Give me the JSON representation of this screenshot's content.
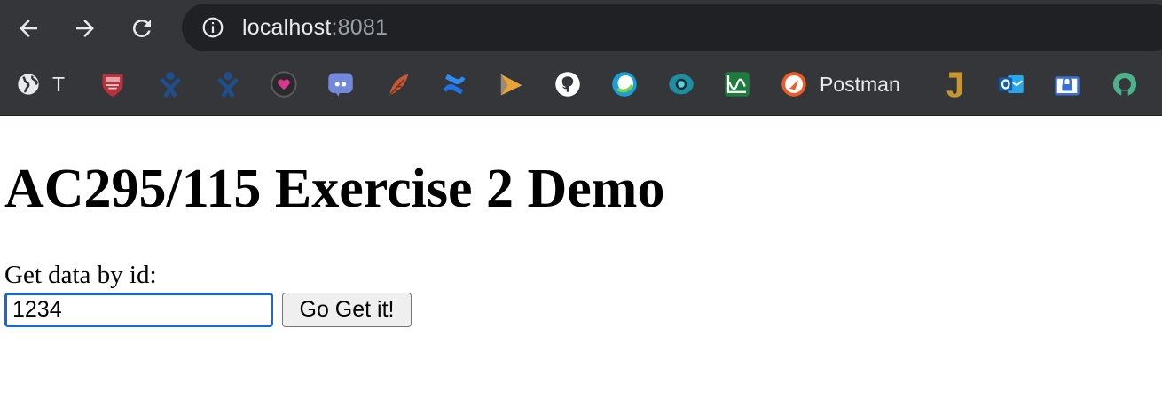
{
  "browser": {
    "url_host": "localhost",
    "url_port": ":8081",
    "bookmarks": [
      {
        "icon": "globe-icon",
        "label": "T"
      },
      {
        "icon": "shield-crest-icon",
        "label": ""
      },
      {
        "icon": "jira-person-icon",
        "label": ""
      },
      {
        "icon": "jira-person-icon",
        "label": ""
      },
      {
        "icon": "heart-icon",
        "label": ""
      },
      {
        "icon": "discord-icon",
        "label": ""
      },
      {
        "icon": "feather-icon",
        "label": ""
      },
      {
        "icon": "confluence-icon",
        "label": ""
      },
      {
        "icon": "play-arrow-icon",
        "label": ""
      },
      {
        "icon": "github-icon",
        "label": ""
      },
      {
        "icon": "circle-swirl-icon",
        "label": ""
      },
      {
        "icon": "eye-icon",
        "label": ""
      },
      {
        "icon": "wave-chart-icon",
        "label": ""
      },
      {
        "icon": "postman-icon",
        "label": "Postman"
      },
      {
        "icon": "j-letter-icon",
        "label": ""
      },
      {
        "icon": "outlook-icon",
        "label": ""
      },
      {
        "icon": "lock-icon",
        "label": ""
      },
      {
        "icon": "ring-icon",
        "label": ""
      }
    ]
  },
  "page": {
    "title": "AC295/115 Exercise 2 Demo",
    "input_label": "Get data by id:",
    "input_value": "1234",
    "button_label": "Go Get it!"
  },
  "colors": {
    "toolbar_bg": "#35363a",
    "omnibox_bg": "#202124",
    "focus_ring": "#1a66d4"
  }
}
